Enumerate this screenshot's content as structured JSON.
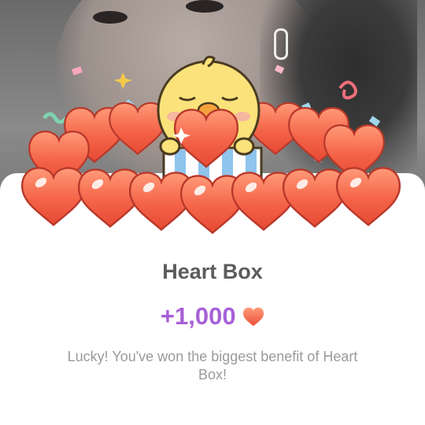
{
  "dialog": {
    "title": "Heart Box",
    "amount": "+1,000",
    "message": "Lucky! You've won the biggest benefit of Heart Box!",
    "amount_icon": "heart-icon"
  },
  "colors": {
    "title": "#5c5c5c",
    "amount": "#a760d6",
    "message": "#9a9a9a",
    "heart": "#f36a4d",
    "panel": "#ffffff"
  }
}
